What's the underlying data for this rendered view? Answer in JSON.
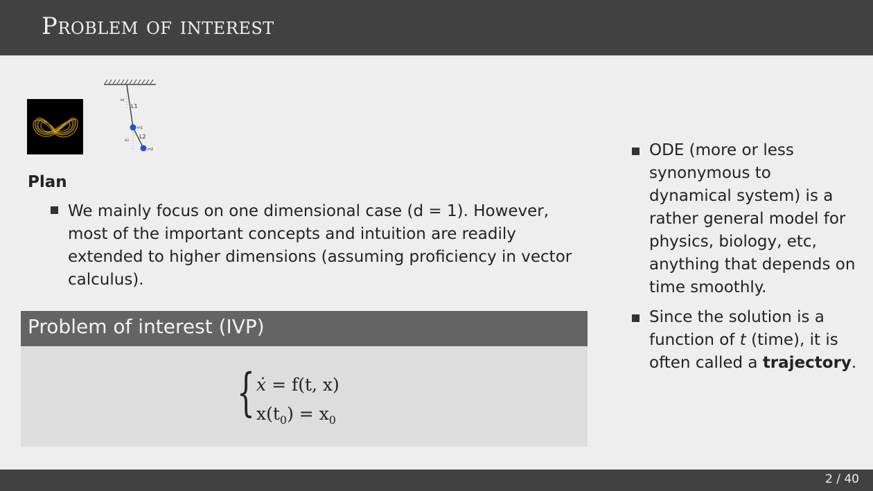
{
  "slide": {
    "title": "Problem of interest",
    "page": "2 / 40"
  },
  "figures": {
    "lorenz_icon": "lorenz-attractor-image",
    "pendulum_icon": "double-pendulum-diagram",
    "pendulum_labels": {
      "l1": "L1",
      "l2": "L2",
      "m1": "m1",
      "m2": "m2",
      "theta1": "θ1",
      "theta2": "θ2"
    }
  },
  "plan": {
    "heading": "Plan",
    "bullet": "We mainly focus on one dimensional case (d = 1). However, most of the important concepts and intuition are readily extended to higher dimensions (assuming proficiency in vector calculus)."
  },
  "block": {
    "title": "Problem of interest (IVP)",
    "eq1_lhs": "ẋ",
    "eq1_rhs": "= f(t, x)",
    "eq2_lhs": "x(t",
    "eq2_sub": "0",
    "eq2_mid": ") = x",
    "eq2_sub2": "0"
  },
  "side": {
    "bullet1": "ODE (more or less synonymous to dynamical system) is a rather general model for physics, biology, etc, anything that depends on time smoothly.",
    "bullet2_pre": "Since the solution is a function of ",
    "bullet2_t": "t",
    "bullet2_mid": " (time), it is often called a ",
    "bullet2_bold": "trajectory",
    "bullet2_end": "."
  },
  "colors": {
    "titlebar": "#414141",
    "block_head": "#646464",
    "block_body": "#dddddd",
    "background": "#eeeeee"
  }
}
